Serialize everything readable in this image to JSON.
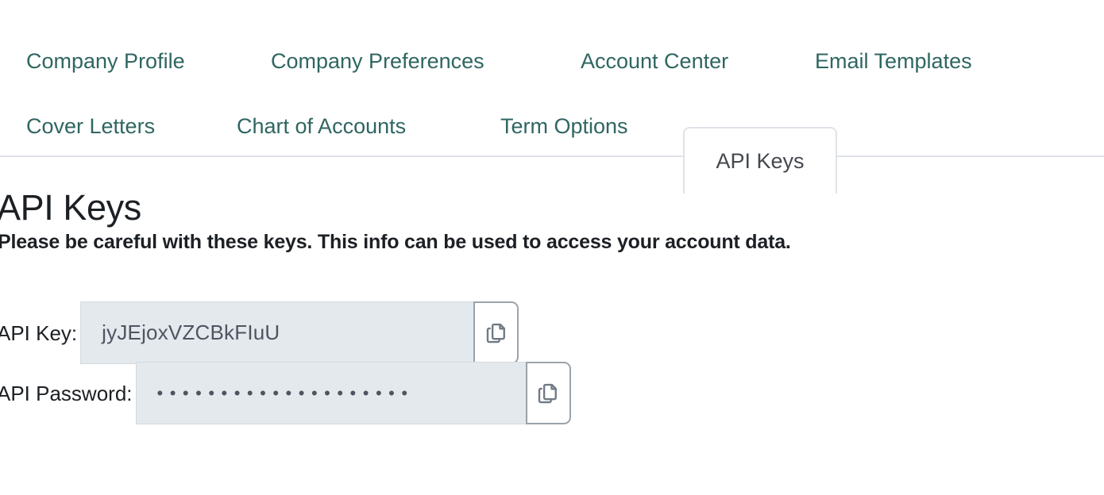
{
  "tabs": {
    "row1": [
      {
        "label": "Company Profile",
        "name": "tab-company-profile"
      },
      {
        "label": "Company Preferences",
        "name": "tab-company-preferences"
      },
      {
        "label": "Account Center",
        "name": "tab-account-center"
      },
      {
        "label": "Email Templates",
        "name": "tab-email-templates"
      }
    ],
    "row2": [
      {
        "label": "Cover Letters",
        "name": "tab-cover-letters"
      },
      {
        "label": "Chart of Accounts",
        "name": "tab-chart-of-accounts"
      },
      {
        "label": "Term Options",
        "name": "tab-term-options"
      }
    ],
    "active": {
      "label": "API Keys",
      "name": "tab-api-keys"
    },
    "link_color": "#2f6661",
    "active_text_color": "#44494f",
    "border_color": "#dfe3e8"
  },
  "main": {
    "title": "API Keys",
    "warning": "Please be careful with these keys. This info can be used to access your account data.",
    "fields": [
      {
        "label": "API Key:",
        "value": "jyJEjoxVZCBkFIuU",
        "masked": false,
        "copy_icon": "copy-icon"
      },
      {
        "label": "API Password:",
        "value": "••••••••••••••••••••",
        "masked": true,
        "copy_icon": "copy-icon"
      }
    ],
    "input_background": "#e4e9ed",
    "input_text_color": "#4e5560",
    "copy_button_border": "#9aa3ab"
  }
}
